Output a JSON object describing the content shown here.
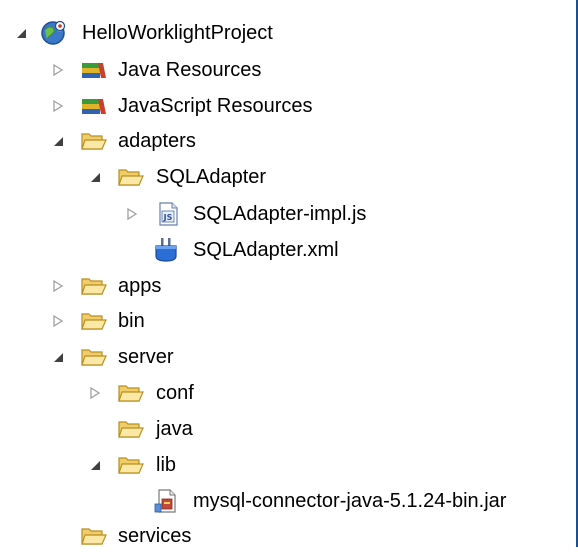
{
  "tree": {
    "root": {
      "label": "HelloWorklightProject",
      "icon": "worklight-project-icon",
      "expanded": true
    },
    "items": [
      {
        "label": "Java Resources",
        "icon": "library-icon",
        "expanded": false
      },
      {
        "label": "JavaScript Resources",
        "icon": "library-icon",
        "expanded": false
      },
      {
        "label": "adapters",
        "icon": "folder-icon",
        "expanded": true
      },
      {
        "label": "SQLAdapter",
        "icon": "folder-icon",
        "expanded": true
      },
      {
        "label": "SQLAdapter-impl.js",
        "icon": "javascript-file-icon",
        "expanded": false
      },
      {
        "label": "SQLAdapter.xml",
        "icon": "adapter-xml-icon"
      },
      {
        "label": "apps",
        "icon": "folder-icon",
        "expanded": false
      },
      {
        "label": "bin",
        "icon": "folder-icon",
        "expanded": false
      },
      {
        "label": "server",
        "icon": "folder-icon",
        "expanded": true
      },
      {
        "label": "conf",
        "icon": "folder-icon",
        "expanded": false
      },
      {
        "label": "java",
        "icon": "folder-icon"
      },
      {
        "label": "lib",
        "icon": "folder-icon",
        "expanded": true
      },
      {
        "label": "mysql-connector-java-5.1.24-bin.jar",
        "icon": "jar-file-icon"
      },
      {
        "label": "services",
        "icon": "folder-icon"
      }
    ]
  },
  "colors": {
    "border": "#1f4e8c",
    "folder_fill": "#f8dc8a",
    "folder_stroke": "#b8901e",
    "triangle_open": "#404040",
    "triangle_closed": "#a0a0a0"
  }
}
